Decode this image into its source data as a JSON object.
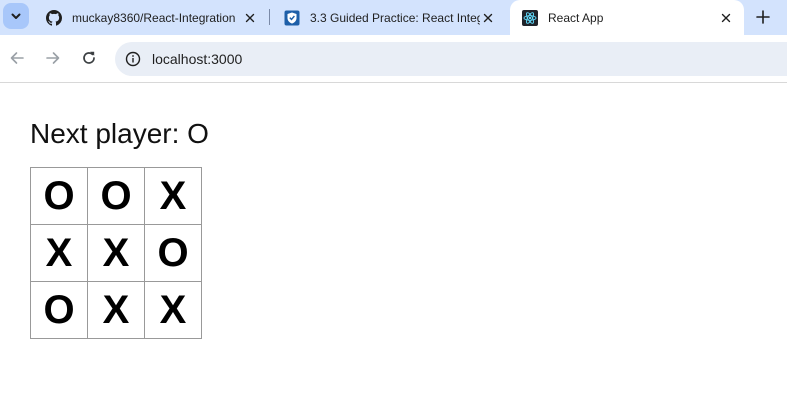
{
  "browser": {
    "tabs": [
      {
        "title": "muckay8360/React-Integration",
        "icon": "github-icon",
        "active": false
      },
      {
        "title": "3.3 Guided Practice: React Integ",
        "icon": "course-shield-icon",
        "active": false
      },
      {
        "title": "React App",
        "icon": "react-icon",
        "active": true
      }
    ],
    "url": "localhost:3000"
  },
  "game": {
    "status": "Next player: O",
    "board": [
      [
        "O",
        "O",
        "X"
      ],
      [
        "X",
        "X",
        "O"
      ],
      [
        "O",
        "X",
        "X"
      ]
    ]
  }
}
